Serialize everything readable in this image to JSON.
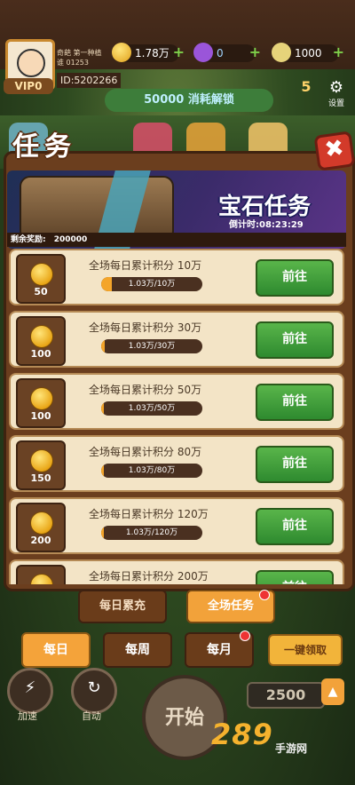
{
  "header": {
    "vip_label": "VIP0",
    "player_name_line": "奇葩  第一种植",
    "player_sub_line": "谁   01253",
    "id_label": "ID:5202266",
    "gold_value": "1.78万",
    "gem_value": "0",
    "money_value": "1000",
    "unlock_banner": "50000 消耗解锁",
    "side_icon_1": "5 领取",
    "settings_label": "设置"
  },
  "panel": {
    "title": "任务",
    "close_symbol": "✖",
    "hero_title": "宝石任务",
    "hero_timer": "倒计时:08:23:29",
    "remaining_label": "剩余奖励:",
    "remaining_value": "200000"
  },
  "tasks": [
    {
      "reward": "50",
      "text": "全场每日累计积分 10万",
      "progress_text": "1.03万/10万",
      "progress": 0.103,
      "button": "前往"
    },
    {
      "reward": "100",
      "text": "全场每日累计积分 30万",
      "progress_text": "1.03万/30万",
      "progress": 0.034,
      "button": "前往"
    },
    {
      "reward": "100",
      "text": "全场每日累计积分 50万",
      "progress_text": "1.03万/50万",
      "progress": 0.021,
      "button": "前往"
    },
    {
      "reward": "150",
      "text": "全场每日累计积分 80万",
      "progress_text": "1.03万/80万",
      "progress": 0.013,
      "button": "前往"
    },
    {
      "reward": "200",
      "text": "全场每日累计积分 120万",
      "progress_text": "1.03万/120万",
      "progress": 0.009,
      "button": "前往"
    },
    {
      "reward": "",
      "text": "全场每日累计积分 200万",
      "progress_text": "",
      "progress": 0.005,
      "button": "前往"
    }
  ],
  "bottom_tabs": {
    "tab1": "每日累充",
    "tab2": "全场任务"
  },
  "periods": {
    "daily": "每日",
    "weekly": "每周",
    "monthly": "每月",
    "claim_all": "一键领取"
  },
  "controls": {
    "speed_label": "加速",
    "auto_label": "自动",
    "start_label": "开始",
    "bet_value": "2500"
  },
  "watermark": {
    "logo": "289",
    "sub": "手游网"
  },
  "colors": {
    "panel_brown": "#6b3e1e",
    "task_bg": "#f3e4c6",
    "go_green": "#3a9a38",
    "active_tab": "#f2a23a"
  }
}
